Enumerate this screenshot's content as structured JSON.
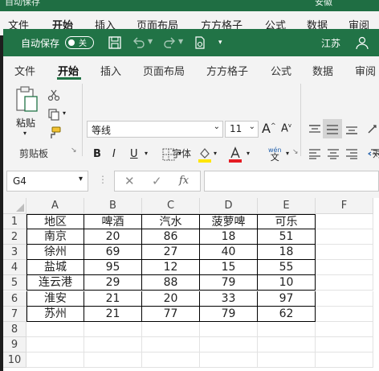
{
  "back_window": {
    "title_left": "自动保存",
    "title_right": "安徽",
    "tabs": [
      "文件",
      "开始",
      "插入",
      "页面布局",
      "方方格子",
      "公式",
      "数据",
      "审阅"
    ]
  },
  "titlebar": {
    "autosave_label": "自动保存",
    "autosave_state": "关",
    "region_label": "江苏"
  },
  "ribbon_tabs": [
    "文件",
    "开始",
    "插入",
    "页面布局",
    "方方格子",
    "公式",
    "数据",
    "审阅"
  ],
  "active_tab": "开始",
  "clipboard": {
    "paste_label": "粘贴",
    "group_label": "剪贴板"
  },
  "font": {
    "name": "等线",
    "size": "11",
    "group_label": "字体",
    "bold": "B",
    "italic": "I",
    "underline": "U",
    "grow": "A",
    "shrink": "A",
    "phonetic_top": "wén",
    "phonetic_bottom": "文"
  },
  "alignment": {
    "group_label_partial": "对"
  },
  "name_box": "G4",
  "formula_bar": {
    "cancel": "✕",
    "enter": "✓",
    "fx": "fx",
    "value": ""
  },
  "sheet": {
    "columns": [
      "A",
      "B",
      "C",
      "D",
      "E",
      "F"
    ],
    "rows": [
      "1",
      "2",
      "3",
      "4",
      "5",
      "6",
      "7",
      "8",
      "9",
      "10"
    ],
    "table": [
      [
        "地区",
        "啤酒",
        "汽水",
        "菠萝啤",
        "可乐"
      ],
      [
        "南京",
        "20",
        "86",
        "18",
        "51"
      ],
      [
        "徐州",
        "69",
        "27",
        "40",
        "18"
      ],
      [
        "盐城",
        "95",
        "12",
        "15",
        "55"
      ],
      [
        "连云港",
        "29",
        "88",
        "79",
        "10"
      ],
      [
        "淮安",
        "21",
        "20",
        "33",
        "97"
      ],
      [
        "苏州",
        "21",
        "77",
        "79",
        "62"
      ]
    ]
  },
  "colors": {
    "excel_green": "#217346",
    "font_color_bar": "#e51c23",
    "highlight_bar": "#ffe600"
  }
}
